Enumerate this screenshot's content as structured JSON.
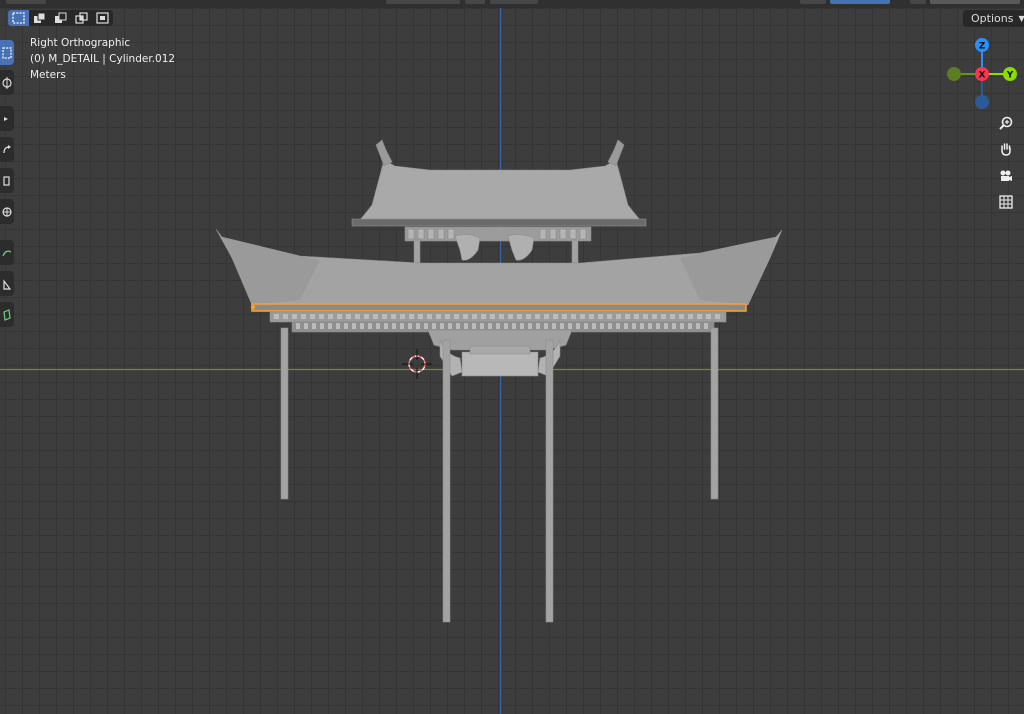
{
  "viewport": {
    "view_name": "Right Orthographic",
    "object_info": "(0) M_DETAIL | Cylinder.012",
    "units": "Meters"
  },
  "header": {
    "options_label": "Options",
    "select_modes": [
      "select-set-new",
      "select-extend",
      "select-subtract",
      "select-intersect",
      "select-invert"
    ]
  },
  "toolbar": {
    "tools": [
      "select-box",
      "cursor",
      "move",
      "rotate",
      "scale",
      "transform",
      "annotate",
      "measure",
      "add-cube"
    ]
  },
  "gizmo": {
    "axes": [
      "Z",
      "X",
      "Y"
    ],
    "colors": {
      "x": "#ff3352",
      "y": "#8bdc00",
      "z": "#2890ff"
    }
  },
  "nav_buttons": [
    "zoom-icon",
    "hand-pan-icon",
    "camera-icon",
    "grid-ortho-icon"
  ],
  "colors": {
    "grid_bg": "#3d3d3d",
    "selection": "#f5a030",
    "mesh": "#a3a3a3",
    "y_axis_line": "#6a8f23",
    "z_axis_line": "#3b64a8"
  }
}
